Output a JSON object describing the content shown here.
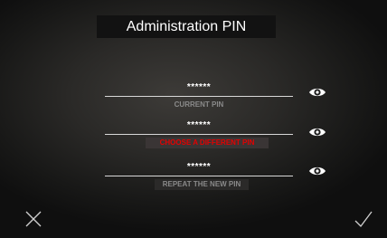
{
  "header": {
    "title": "Administration PIN"
  },
  "fields": [
    {
      "value": "******",
      "label": "CURRENT PIN",
      "state": "normal"
    },
    {
      "value": "******",
      "label": "CHOOSE A DIFFERENT PIN",
      "state": "error"
    },
    {
      "value": "******",
      "label": "REPEAT THE NEW PIN",
      "state": "normal"
    }
  ],
  "icons": {
    "toggle_visibility": "eye-icon",
    "cancel": "close-icon",
    "confirm": "checkmark-icon"
  },
  "colors": {
    "text": "#ffffff",
    "label": "#8a8a8a",
    "error": "#e60000",
    "title_bg": "#121212"
  }
}
